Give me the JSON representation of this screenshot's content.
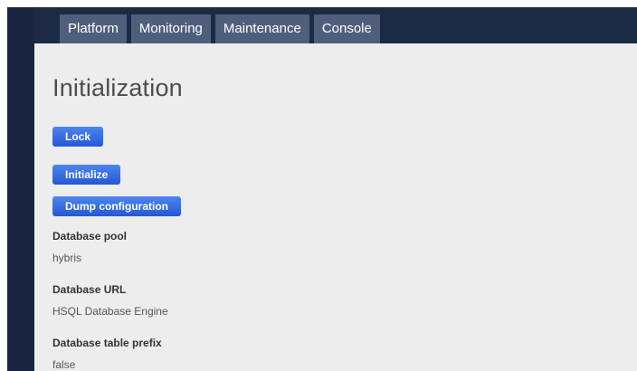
{
  "nav": {
    "tabs": [
      {
        "label": "Platform"
      },
      {
        "label": "Monitoring"
      },
      {
        "label": "Maintenance"
      },
      {
        "label": "Console"
      }
    ]
  },
  "page": {
    "title": "Initialization"
  },
  "actions": {
    "lock_label": "Lock",
    "initialize_label": "Initialize",
    "dump_label": "Dump configuration"
  },
  "properties": [
    {
      "label": "Database pool",
      "value": "hybris"
    },
    {
      "label": "Database URL",
      "value": "HSQL Database Engine"
    },
    {
      "label": "Database table prefix",
      "value": "false"
    }
  ],
  "colors": {
    "frame": "#1d2a44",
    "tab": "#4f5f7b",
    "content_bg": "#ededed",
    "button": "#2f66e0"
  }
}
